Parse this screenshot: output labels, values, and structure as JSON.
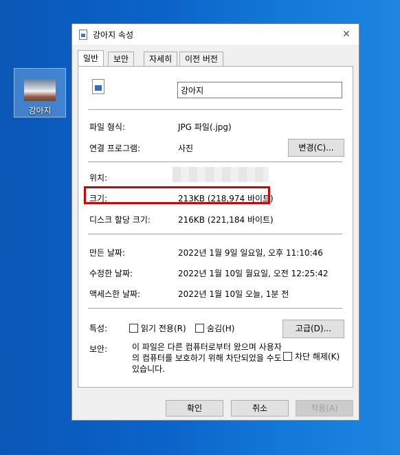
{
  "desktop": {
    "icon_label": "강아지"
  },
  "window": {
    "title": "강아지 속성",
    "close_glyph": "✕"
  },
  "tabs": [
    {
      "label": "일반"
    },
    {
      "label": "보안"
    },
    {
      "label": "자세히"
    },
    {
      "label": "이전 버전"
    }
  ],
  "general": {
    "file_name": "강아지",
    "type_label": "파일 형식:",
    "type_value": "JPG 파일(.jpg)",
    "opens_with_label": "연결 프로그램:",
    "opens_with_value": "사진",
    "change_button": "변경(C)...",
    "location_label": "위치:",
    "size_label": "크기:",
    "size_value": "213KB (218,974 바이트)",
    "disk_size_label": "디스크 할당 크기:",
    "disk_size_value": "216KB (221,184 바이트)",
    "created_label": "만든 날짜:",
    "created_value": "2022년 1월 9일 일요일, 오후 11:10:46",
    "modified_label": "수정한 날짜:",
    "modified_value": "2022년 1월 10일 월요일, 오전 12:25:42",
    "accessed_label": "액세스한 날짜:",
    "accessed_value": "2022년 1월 10일 오늘, 1분 전",
    "attributes_label": "특성:",
    "readonly_label": "읽기 전용(R)",
    "hidden_label": "숨김(H)",
    "advanced_button": "고급(D)...",
    "security_label": "보안:",
    "security_text": "이 파일은 다른 컴퓨터로부터 왔으며 사용자의 컴퓨터를 보호하기 위해 차단되었을 수도 있습니다.",
    "unblock_label": "차단 해제(K)"
  },
  "footer": {
    "ok": "확인",
    "cancel": "취소",
    "apply": "적용(A)"
  }
}
